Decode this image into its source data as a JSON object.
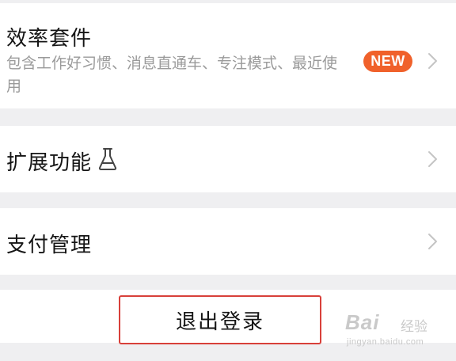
{
  "efficiency_suite": {
    "title": "效率套件",
    "description": "包含工作好习惯、消息直通车、专注模式、最近使用",
    "badge": "NEW",
    "chevron_icon": "chevron-right-icon"
  },
  "extensions": {
    "title": "扩展功能",
    "lab_icon": "flask-icon",
    "chevron_icon": "chevron-right-icon"
  },
  "payment": {
    "title": "支付管理",
    "chevron_icon": "chevron-right-icon"
  },
  "logout": {
    "label": "退出登录"
  },
  "watermark": {
    "brand": "Bai",
    "sub": "经验",
    "url": "jingyan.baidu.com"
  },
  "colors": {
    "background": "#efeff1",
    "card": "#ffffff",
    "badge": "#f0612b",
    "logout_border": "#d8403a",
    "secondary_text": "#9a9a9a",
    "chevron": "#c4c4c4"
  }
}
